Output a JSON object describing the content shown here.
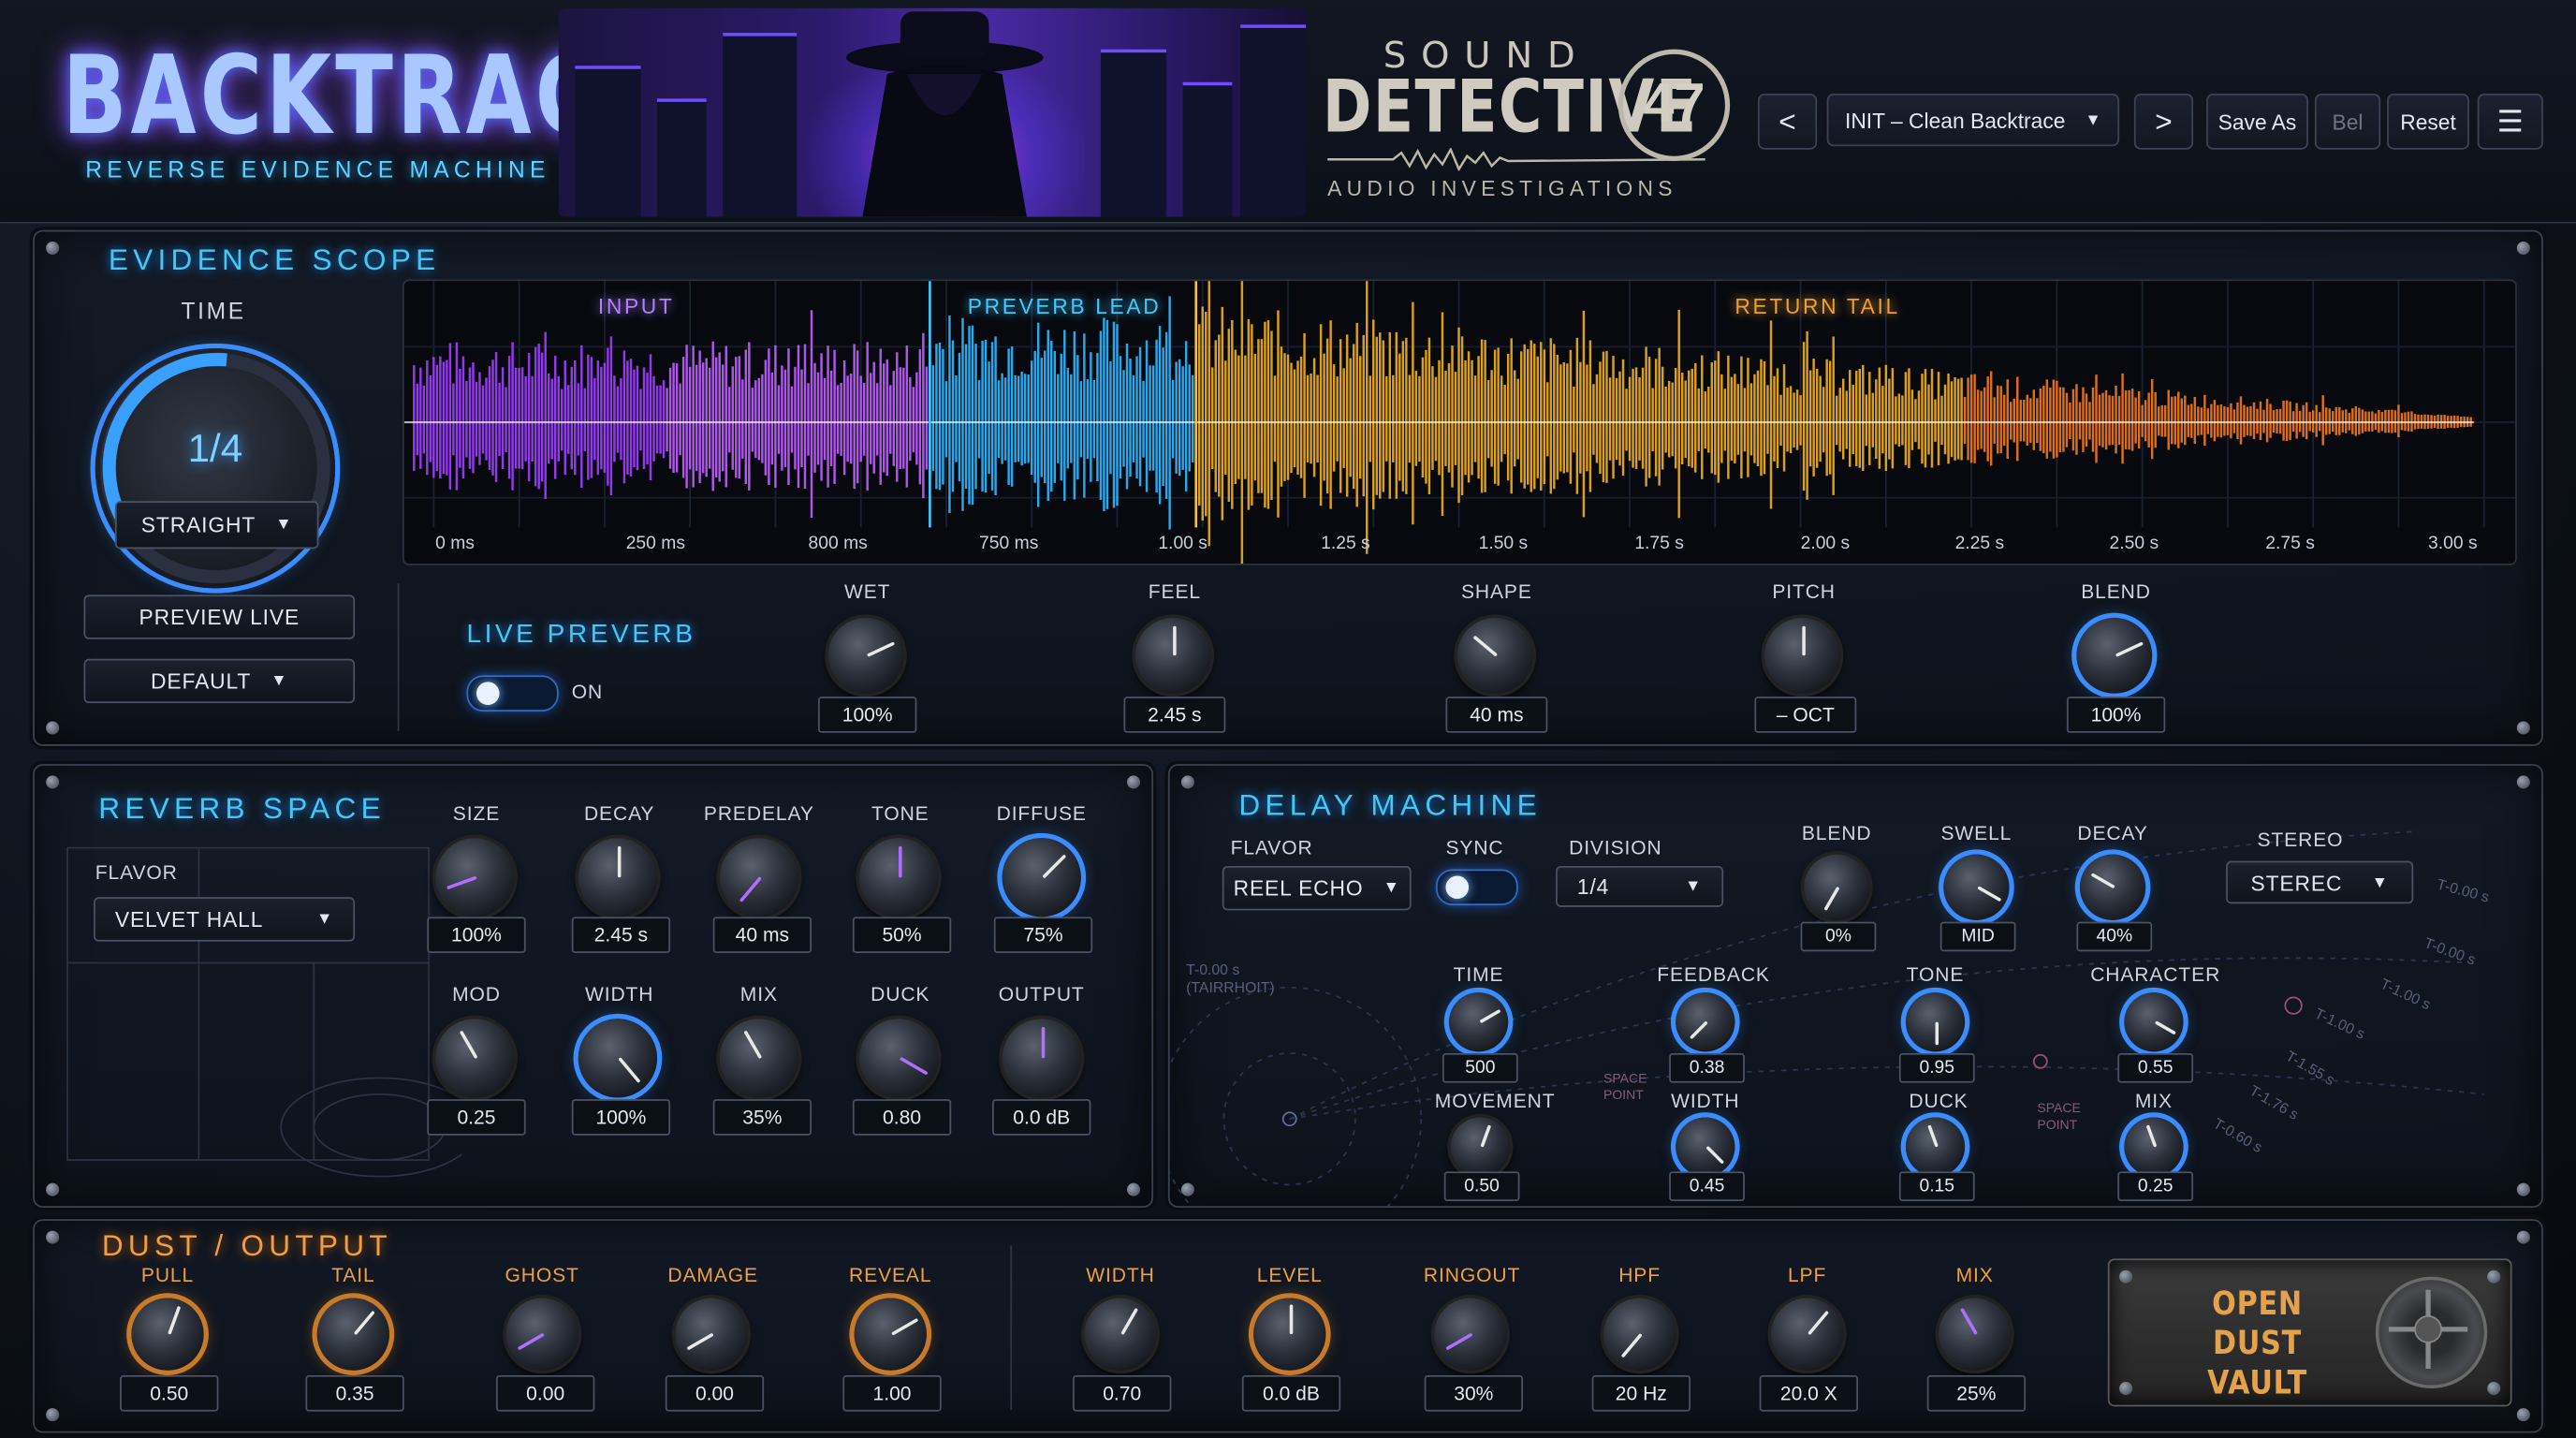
{
  "header": {
    "title": "BACKTRACE",
    "subtitle": "REVERSE EVIDENCE MACHINE",
    "logo": {
      "top": "SOUND",
      "main": "DETECTIVE",
      "number": "47",
      "bottom": "AUDIO INVESTIGATIONS"
    },
    "preset": {
      "prev": "<",
      "name": "INIT – Clean Backtrace",
      "next": ">"
    },
    "save_as": "Save As",
    "bel": "Bel",
    "reset": "Reset",
    "menu_icon": "hamburger-icon"
  },
  "evidence_scope": {
    "title": "EVIDENCE SCOPE",
    "time_label": "TIME",
    "time_value": "1/4",
    "time_mode": "STRAIGHT",
    "preview_live": "PREVIEW LIVE",
    "default": "DEFAULT",
    "zones": [
      "INPUT",
      "PREVERB LEAD",
      "RETURN TAIL"
    ],
    "zone_colors": [
      "#b080ff",
      "#40c8ff",
      "#f0a030"
    ],
    "ticks": [
      "0 ms",
      "250 ms",
      "800 ms",
      "750 ms",
      "1.00 s",
      "1.25 s",
      "1.50 s",
      "1.75 s",
      "2.00 s",
      "2.25 s",
      "2.50 s",
      "2.75 s",
      "3.00 s"
    ],
    "live_preverb": "LIVE PREVERB",
    "live_toggle": "ON",
    "knobs": [
      {
        "label": "WET",
        "value": "100%"
      },
      {
        "label": "FEEL",
        "value": "2.45 s"
      },
      {
        "label": "SHAPE",
        "value": "40 ms"
      },
      {
        "label": "PITCH",
        "value": "– OCT"
      },
      {
        "label": "BLEND",
        "value": "100%"
      }
    ]
  },
  "reverb_space": {
    "title": "REVERB SPACE",
    "flavor_label": "FLAVOR",
    "flavor": "VELVET HALL",
    "row1": [
      {
        "label": "SIZE",
        "value": "100%"
      },
      {
        "label": "DECAY",
        "value": "2.45 s"
      },
      {
        "label": "PREDELAY",
        "value": "40 ms"
      },
      {
        "label": "TONE",
        "value": "50%"
      },
      {
        "label": "DIFFUSE",
        "value": "75%"
      }
    ],
    "row2": [
      {
        "label": "MOD",
        "value": "0.25"
      },
      {
        "label": "WIDTH",
        "value": "100%"
      },
      {
        "label": "MIX",
        "value": "35%"
      },
      {
        "label": "DUCK",
        "value": "0.80"
      },
      {
        "label": "OUTPUT",
        "value": "0.0 dB"
      }
    ]
  },
  "delay_machine": {
    "title": "DELAY MACHINE",
    "flavor_label": "FLAVOR",
    "flavor": "REEL ECHO",
    "sync_label": "SYNC",
    "division_label": "DIVISION",
    "division": "1/4",
    "stereo_label": "STEREO",
    "stereo": "STEREC",
    "top_knobs": [
      {
        "label": "BLEND",
        "value": "0%"
      },
      {
        "label": "SWELL",
        "value": "MID"
      },
      {
        "label": "DECAY",
        "value": "40%"
      }
    ],
    "row1": [
      {
        "label": "TIME",
        "value": "500"
      },
      {
        "label": "FEEDBACK",
        "value": "0.38"
      },
      {
        "label": "TONE",
        "value": "0.95"
      },
      {
        "label": "CHARACTER",
        "value": "0.55"
      }
    ],
    "row2": [
      {
        "label": "MOVEMENT",
        "value": "0.50"
      },
      {
        "label": "WIDTH",
        "value": "0.45"
      },
      {
        "label": "DUCK",
        "value": "0.15"
      },
      {
        "label": "MIX",
        "value": "0.25"
      }
    ],
    "map_notes": [
      "T-0.00 s",
      "(TAIRRHOIT)",
      "SPACE POINT",
      "SPACE POINT",
      "T-0.00 s",
      "T-0.00 s",
      "T-1.00 s",
      "T-1.00 s",
      "T-1.55 s",
      "T-1.76 s",
      "T-0.60 s"
    ]
  },
  "dust_output": {
    "title": "DUST / OUTPUT",
    "left_knobs": [
      {
        "label": "PULL",
        "value": "0.50"
      },
      {
        "label": "TAIL",
        "value": "0.35"
      },
      {
        "label": "GHOST",
        "value": "0.00"
      },
      {
        "label": "DAMAGE",
        "value": "0.00"
      },
      {
        "label": "REVEAL",
        "value": "1.00"
      }
    ],
    "right_knobs": [
      {
        "label": "WIDTH",
        "value": "0.70"
      },
      {
        "label": "LEVEL",
        "value": "0.0 dB"
      },
      {
        "label": "RINGOUT",
        "value": "30%"
      },
      {
        "label": "HPF",
        "value": "20 Hz"
      },
      {
        "label": "LPF",
        "value": "20.0 X"
      },
      {
        "label": "MIX",
        "value": "25%"
      }
    ],
    "vault_line1": "OPEN",
    "vault_line2": "DUST VAULT"
  }
}
